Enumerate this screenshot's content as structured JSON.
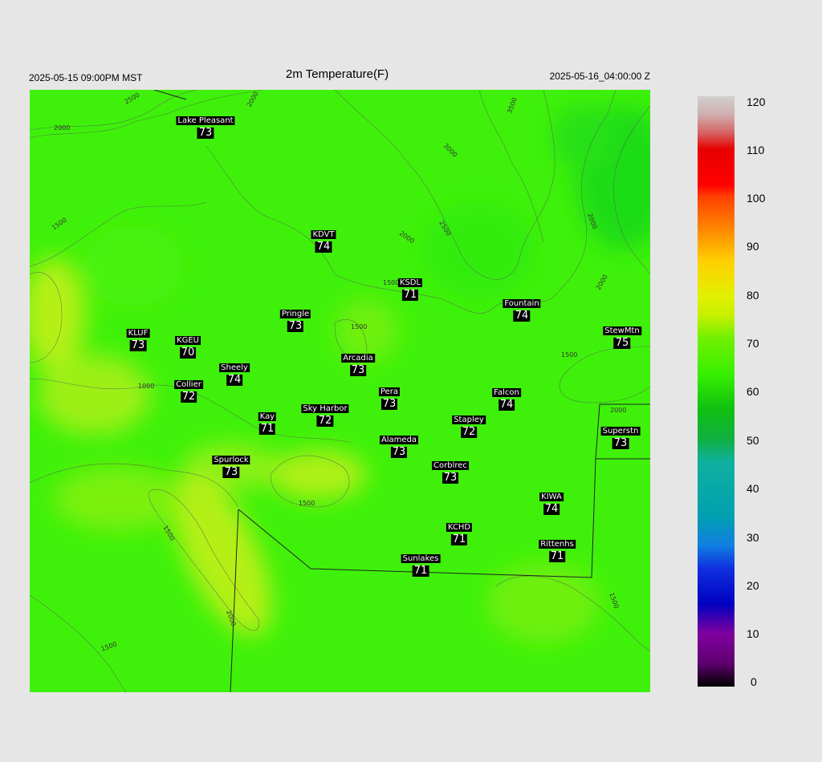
{
  "header": {
    "local_time": "2025-05-15 09:00PM MST",
    "title": "2m Temperature(F)",
    "utc_time": "2025-05-16_04:00:00 Z"
  },
  "stations": [
    {
      "name": "Lake Pleasant",
      "value": "73"
    },
    {
      "name": "KDVT",
      "value": "74"
    },
    {
      "name": "KSDL",
      "value": "71"
    },
    {
      "name": "Fountain",
      "value": "74"
    },
    {
      "name": "StewMtn",
      "value": "75"
    },
    {
      "name": "Pringle",
      "value": "73"
    },
    {
      "name": "KLUF",
      "value": "73"
    },
    {
      "name": "KGEU",
      "value": "70"
    },
    {
      "name": "Arcadia",
      "value": "73"
    },
    {
      "name": "Sheely",
      "value": "74"
    },
    {
      "name": "Collier",
      "value": "72"
    },
    {
      "name": "Pera",
      "value": "73"
    },
    {
      "name": "Falcon",
      "value": "74"
    },
    {
      "name": "Kay",
      "value": "71"
    },
    {
      "name": "Sky Harbor",
      "value": "72"
    },
    {
      "name": "Stapley",
      "value": "72"
    },
    {
      "name": "Superstn",
      "value": "73"
    },
    {
      "name": "Alameda",
      "value": "73"
    },
    {
      "name": "Spurlock",
      "value": "73"
    },
    {
      "name": "Corblrec",
      "value": "73"
    },
    {
      "name": "KIWA",
      "value": "74"
    },
    {
      "name": "KCHD",
      "value": "71"
    },
    {
      "name": "Rittenhs",
      "value": "71"
    },
    {
      "name": "Sunlakes",
      "value": "71"
    }
  ],
  "contour_labels": [
    "2500",
    "2000",
    "3500",
    "3000",
    "1500",
    "1000"
  ],
  "colorbar": {
    "ticks": [
      "120",
      "110",
      "100",
      "90",
      "80",
      "70",
      "60",
      "50",
      "40",
      "30",
      "20",
      "10",
      "0"
    ],
    "colors": [
      "#d0d0d0",
      "#d46a6a",
      "#e80000",
      "#ff6000",
      "#ffd000",
      "#c8f000",
      "#38f000",
      "#10b010",
      "#10b0a0",
      "#00a0b0",
      "#1060e0",
      "#0000c0",
      "#8000a0",
      "#000000"
    ]
  },
  "legend_map": {
    "field_color": "#3ff10a",
    "warm_color": "#b4f019",
    "cool_color": "#1fdc16"
  }
}
